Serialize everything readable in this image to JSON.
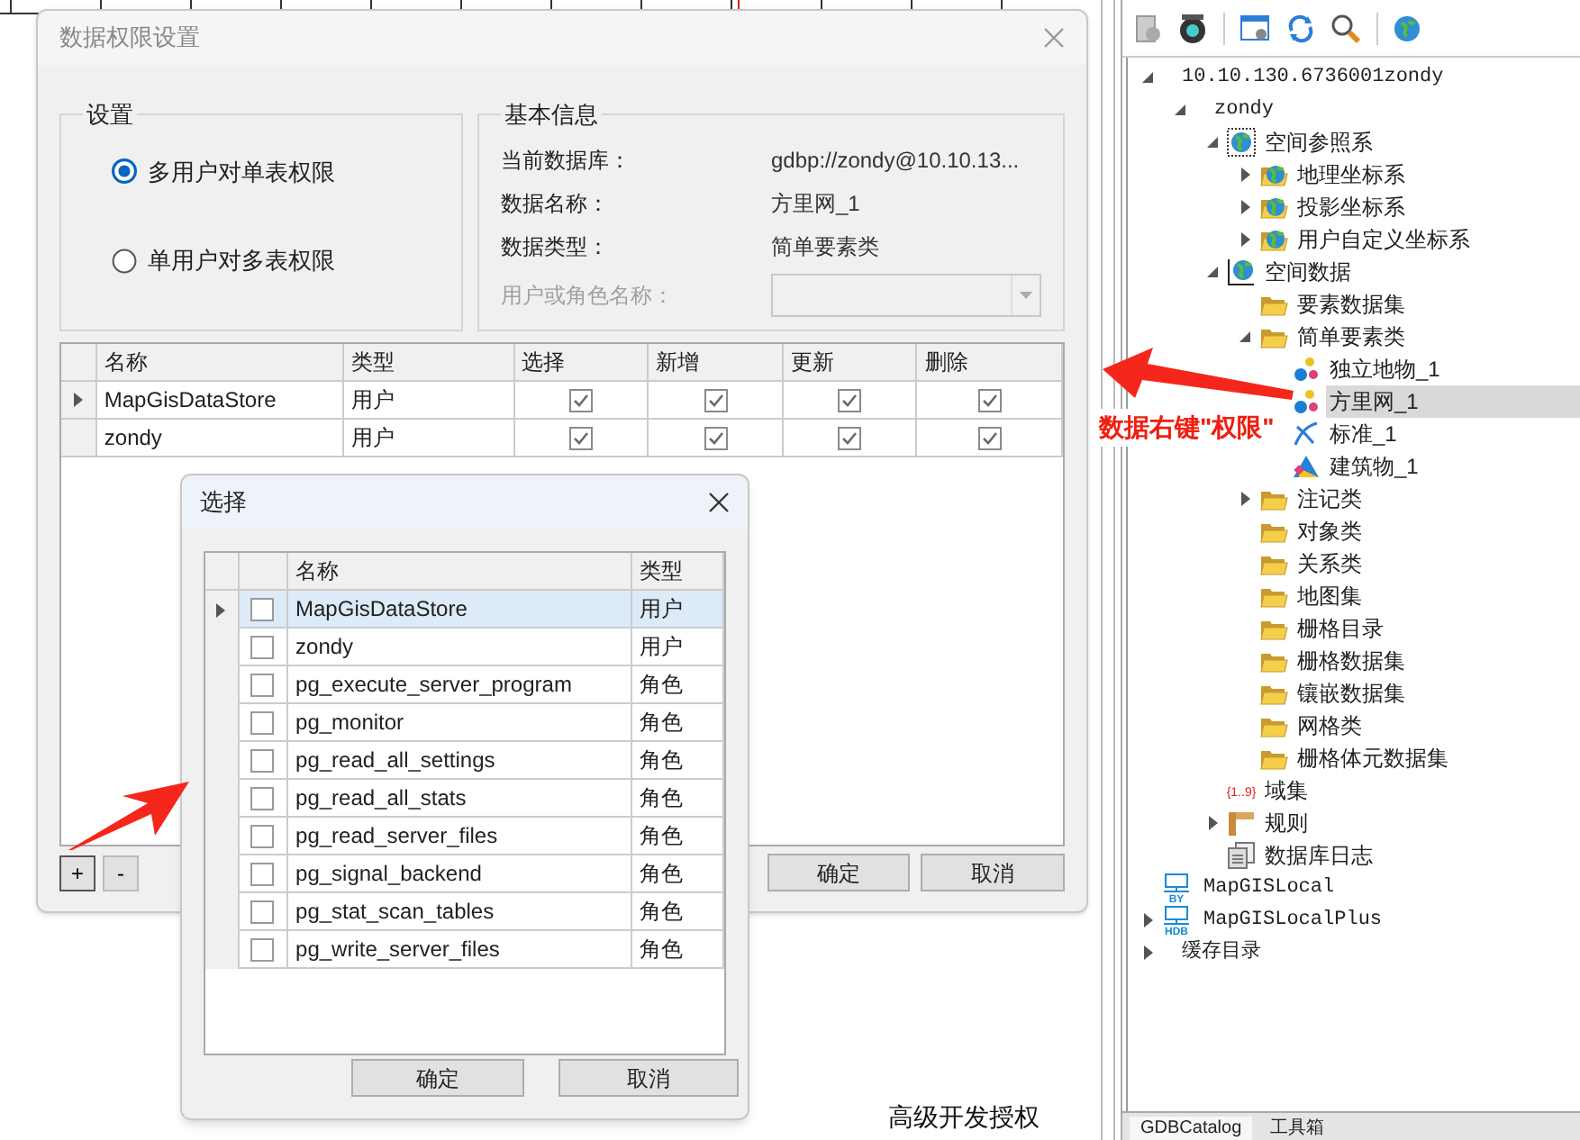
{
  "main_dialog": {
    "title": "数据权限设置",
    "settings": {
      "title": "设置",
      "options": [
        {
          "label": "多用户对单表权限",
          "selected": true
        },
        {
          "label": "单用户对多表权限",
          "selected": false
        }
      ]
    },
    "basic_info": {
      "title": "基本信息",
      "fields": [
        {
          "label": "当前数据库：",
          "value": "gdbp://zondy@10.10.13..."
        },
        {
          "label": "数据名称：",
          "value": "方里网_1"
        },
        {
          "label": "数据类型：",
          "value": "简单要素类"
        }
      ],
      "user_field": {
        "label": "用户或角色名称：",
        "disabled": true
      }
    },
    "grid": {
      "columns": [
        "名称",
        "类型",
        "选择",
        "新增",
        "更新",
        "删除"
      ],
      "rows": [
        {
          "name": "MapGisDataStore",
          "type": "用户",
          "selected": true,
          "permissions": [
            {
              "checked": true
            },
            {
              "checked": true
            },
            {
              "checked": true
            },
            {
              "checked": true
            }
          ]
        },
        {
          "name": "zondy",
          "type": "用户",
          "selected": false,
          "permissions": [
            {
              "checked": true
            },
            {
              "checked": true
            },
            {
              "checked": true
            },
            {
              "checked": true
            }
          ]
        }
      ]
    },
    "add_button": "+",
    "remove_button": "-",
    "buttons": [
      "确定",
      "取消"
    ]
  },
  "select_dialog": {
    "title": "选择",
    "columns": [
      "名称",
      "类型"
    ],
    "rows": [
      {
        "name": "MapGisDataStore",
        "type": "用户",
        "checked": false,
        "selected": true
      },
      {
        "name": "zondy",
        "type": "用户",
        "checked": false,
        "selected": false
      },
      {
        "name": "pg_execute_server_program",
        "type": "角色",
        "checked": false,
        "selected": false
      },
      {
        "name": "pg_monitor",
        "type": "角色",
        "checked": false,
        "selected": false
      },
      {
        "name": "pg_read_all_settings",
        "type": "角色",
        "checked": false,
        "selected": false
      },
      {
        "name": "pg_read_all_stats",
        "type": "角色",
        "checked": false,
        "selected": false
      },
      {
        "name": "pg_read_server_files",
        "type": "角色",
        "checked": false,
        "selected": false
      },
      {
        "name": "pg_signal_backend",
        "type": "角色",
        "checked": false,
        "selected": false
      },
      {
        "name": "pg_stat_scan_tables",
        "type": "角色",
        "checked": false,
        "selected": false
      },
      {
        "name": "pg_write_server_files",
        "type": "角色",
        "checked": false,
        "selected": false
      }
    ],
    "buttons": [
      "确定",
      "取消"
    ]
  },
  "annotation": "数据右键\"权限\"",
  "footer_text": "高级开发授权",
  "tree": [
    {
      "label": "10.10.130.6736001zondy",
      "kind": "server",
      "expanded": true,
      "selected": false,
      "children": [
        {
          "label": "zondy",
          "kind": "database",
          "expanded": true,
          "selected": false,
          "children": [
            {
              "label": "空间参照系",
              "kind": "globe",
              "expanded": true,
              "selected": false,
              "children": [
                {
                  "label": "地理坐标系",
                  "kind": "globe-folder",
                  "expanded": false,
                  "selected": false
                },
                {
                  "label": "投影坐标系",
                  "kind": "globe-folder",
                  "expanded": false,
                  "selected": false
                },
                {
                  "label": "用户自定义坐标系",
                  "kind": "globe-folder",
                  "expanded": false,
                  "selected": false
                }
              ]
            },
            {
              "label": "空间数据",
              "kind": "globe-axes",
              "expanded": true,
              "selected": false,
              "children": [
                {
                  "label": "要素数据集",
                  "kind": "folder",
                  "selected": false
                },
                {
                  "label": "简单要素类",
                  "kind": "folder",
                  "expanded": true,
                  "selected": false,
                  "children": [
                    {
                      "label": "独立地物_1",
                      "kind": "point",
                      "selected": false
                    },
                    {
                      "label": "方里网_1",
                      "kind": "point",
                      "selected": true
                    },
                    {
                      "label": "标准_1",
                      "kind": "line",
                      "selected": false
                    },
                    {
                      "label": "建筑物_1",
                      "kind": "polygon",
                      "selected": false
                    }
                  ]
                },
                {
                  "label": "注记类",
                  "kind": "folder",
                  "expanded": false,
                  "selected": false
                },
                {
                  "label": "对象类",
                  "kind": "folder",
                  "selected": false
                },
                {
                  "label": "关系类",
                  "kind": "folder",
                  "selected": false
                },
                {
                  "label": "地图集",
                  "kind": "folder",
                  "selected": false
                },
                {
                  "label": "栅格目录",
                  "kind": "folder",
                  "selected": false
                },
                {
                  "label": "栅格数据集",
                  "kind": "folder",
                  "selected": false
                },
                {
                  "label": "镶嵌数据集",
                  "kind": "folder",
                  "selected": false
                },
                {
                  "label": "网格类",
                  "kind": "folder",
                  "selected": false
                },
                {
                  "label": "栅格体元数据集",
                  "kind": "folder",
                  "selected": false
                }
              ]
            },
            {
              "label": "域集",
              "kind": "domain",
              "icon_text": "{1..9}",
              "selected": false
            },
            {
              "label": "规则",
              "kind": "rule",
              "expanded": false,
              "selected": false
            },
            {
              "label": "数据库日志",
              "kind": "log",
              "selected": false
            }
          ]
        }
      ]
    },
    {
      "label": "MapGISLocal",
      "kind": "db-by",
      "icon_text": "BY",
      "selected": false
    },
    {
      "label": "MapGISLocalPlus",
      "kind": "db-hdb",
      "icon_text": "HDB",
      "expanded": false,
      "selected": false
    },
    {
      "label": "缓存目录",
      "kind": "cache",
      "expanded": false,
      "selected": false
    }
  ],
  "bottom_tabs": [
    {
      "label": "GDBCatalog",
      "selected": true
    },
    {
      "label": "工具箱",
      "selected": false
    }
  ]
}
